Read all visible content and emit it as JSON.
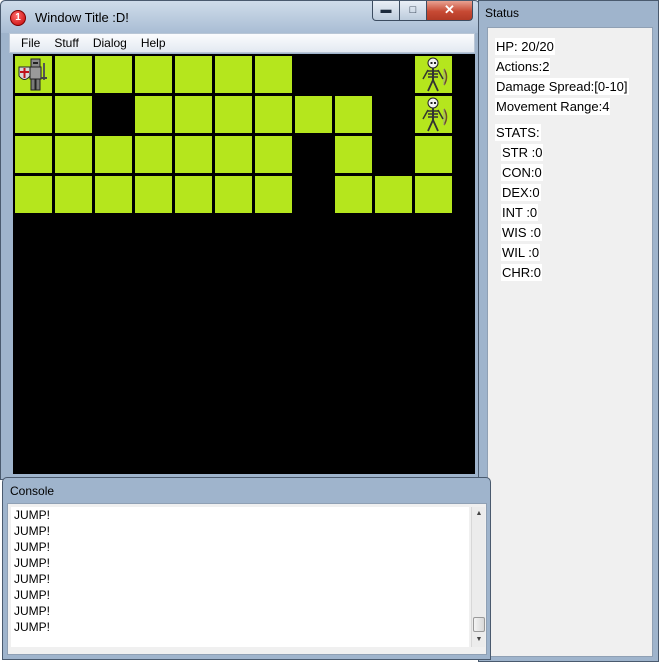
{
  "main_window": {
    "title": "Window Title :D!",
    "app_icon_label": "1",
    "controls": {
      "minimize": "▬",
      "maximize": "□",
      "close": "✕"
    }
  },
  "menu": {
    "items": [
      "File",
      "Stuff",
      "Dialog",
      "Help"
    ]
  },
  "game": {
    "colors": {
      "grass": "#b5e61d",
      "background": "#000000"
    },
    "columns": 11,
    "rows": [
      [
        1,
        1,
        1,
        1,
        1,
        1,
        1,
        0,
        0,
        0,
        1
      ],
      [
        1,
        1,
        0,
        1,
        1,
        1,
        1,
        1,
        1,
        0,
        1
      ],
      [
        1,
        1,
        1,
        1,
        1,
        1,
        1,
        0,
        1,
        0,
        1
      ],
      [
        1,
        1,
        1,
        1,
        1,
        1,
        1,
        0,
        1,
        1,
        1
      ]
    ],
    "units": [
      {
        "type": "knight",
        "icon": "knight-icon",
        "col": 0,
        "row": 0
      },
      {
        "type": "skeleton",
        "icon": "skeleton-icon",
        "col": 10,
        "row": 0
      },
      {
        "type": "skeleton",
        "icon": "skeleton-icon",
        "col": 10,
        "row": 1
      }
    ]
  },
  "status": {
    "title": "Status",
    "hp": "HP: 20/20",
    "actions": "Actions:2",
    "damage_spread": "Damage Spread:[0-10]",
    "movement_range": "Movement Range:4",
    "stats_header": "STATS:",
    "stats": [
      "STR :0",
      "CON:0",
      "DEX:0",
      "INT  :0",
      "WIS :0",
      "WIL :0",
      "CHR:0"
    ]
  },
  "console": {
    "title": "Console",
    "lines": [
      "JUMP!",
      "JUMP!",
      "JUMP!",
      "JUMP!",
      "JUMP!",
      "JUMP!",
      "JUMP!",
      "JUMP!"
    ],
    "scroll_up": "▲",
    "scroll_down": "▼"
  }
}
